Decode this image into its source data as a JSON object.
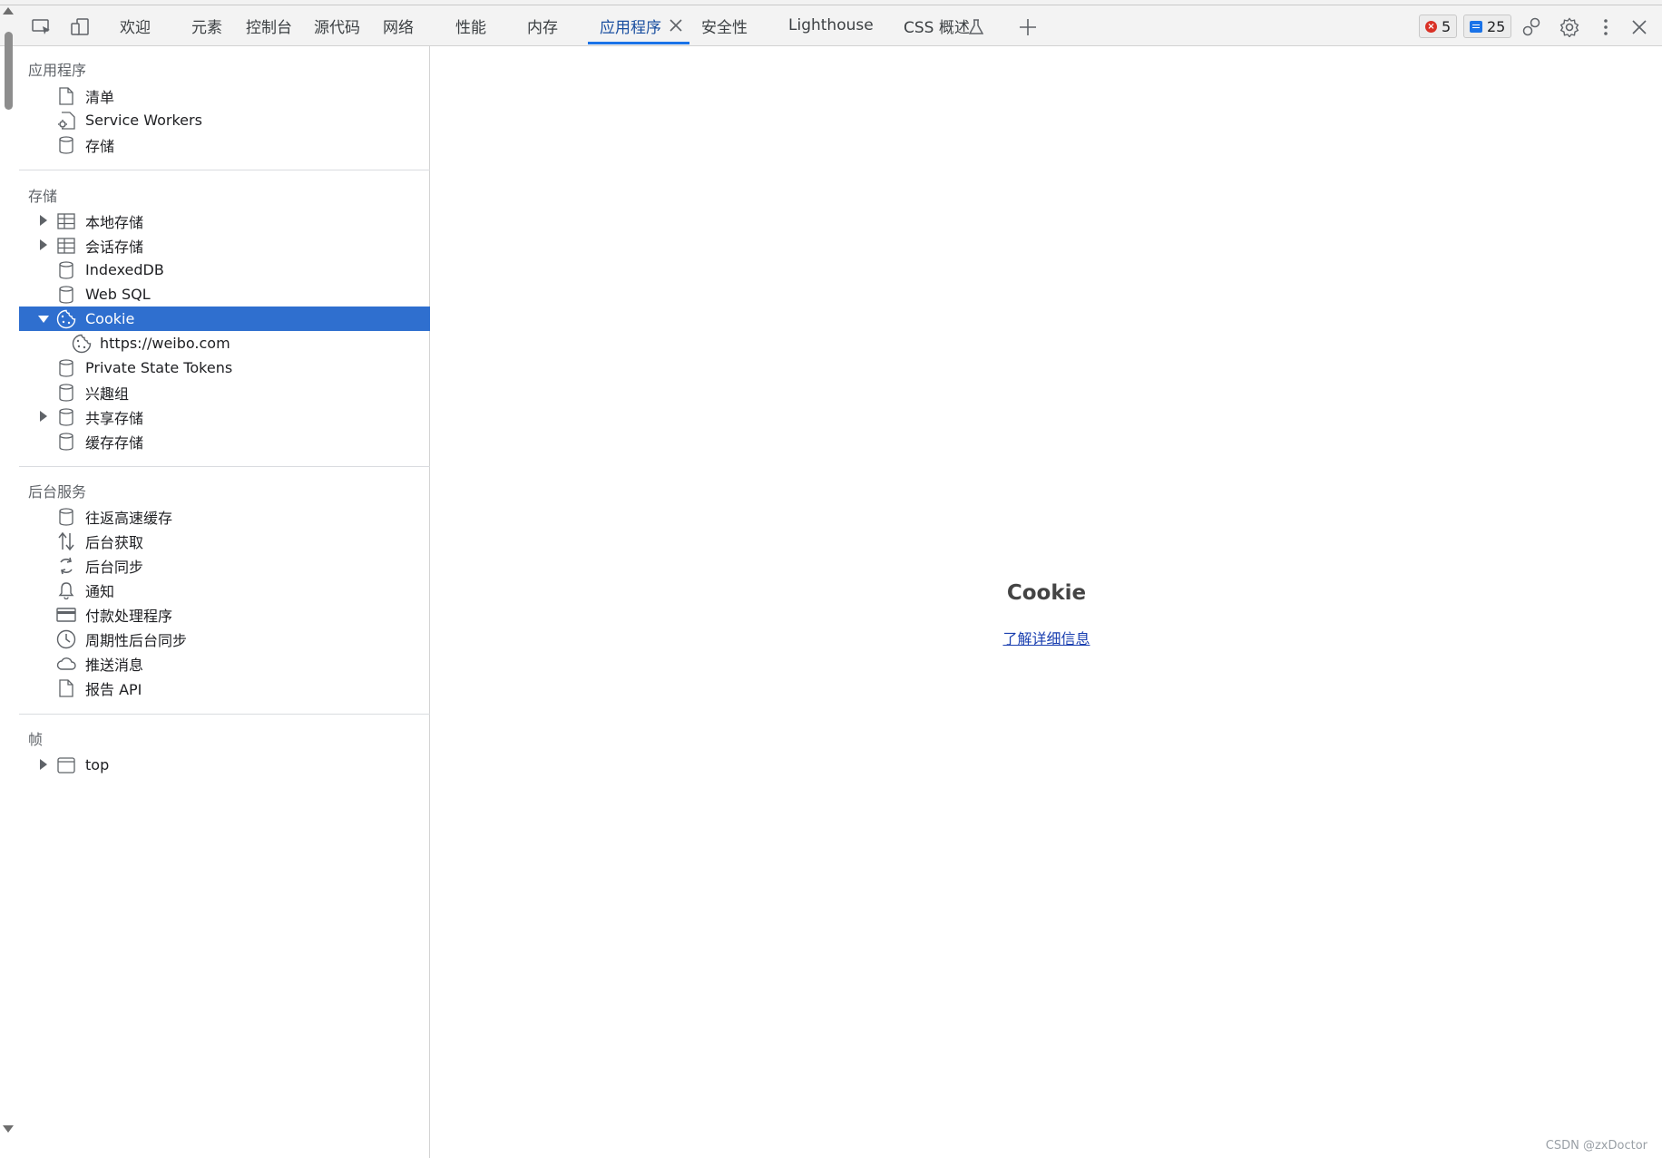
{
  "toolbar": {
    "tabs": [
      {
        "label": "欢迎"
      },
      {
        "label": "元素"
      },
      {
        "label": "控制台"
      },
      {
        "label": "源代码"
      },
      {
        "label": "网络"
      },
      {
        "label": "性能"
      },
      {
        "label": "内存"
      },
      {
        "label": "应用程序"
      },
      {
        "label": "安全性"
      },
      {
        "label": "Lighthouse"
      },
      {
        "label": "CSS 概述"
      }
    ],
    "active_tab": "应用程序",
    "error_count": "5",
    "message_count": "25"
  },
  "sidebar": {
    "app_section": {
      "title": "应用程序",
      "items": [
        {
          "label": "清单",
          "icon": "document-icon"
        },
        {
          "label": "Service Workers",
          "icon": "service-worker-icon"
        },
        {
          "label": "存储",
          "icon": "database-icon"
        }
      ]
    },
    "storage_section": {
      "title": "存储",
      "items": [
        {
          "label": "本地存储",
          "icon": "table-icon",
          "expandable": true
        },
        {
          "label": "会话存储",
          "icon": "table-icon",
          "expandable": true
        },
        {
          "label": "IndexedDB",
          "icon": "database-icon"
        },
        {
          "label": "Web SQL",
          "icon": "database-icon"
        },
        {
          "label": "Cookie",
          "icon": "cookie-icon",
          "expanded": true,
          "selected": true
        },
        {
          "label": "https://weibo.com",
          "icon": "cookie-icon",
          "child": true
        },
        {
          "label": "Private State Tokens",
          "icon": "database-icon"
        },
        {
          "label": "兴趣组",
          "icon": "database-icon"
        },
        {
          "label": "共享存储",
          "icon": "database-icon",
          "expandable": true
        },
        {
          "label": "缓存存储",
          "icon": "database-icon"
        }
      ]
    },
    "background_section": {
      "title": "后台服务",
      "items": [
        {
          "label": "往返高速缓存",
          "icon": "database-icon"
        },
        {
          "label": "后台获取",
          "icon": "arrows-updown-icon"
        },
        {
          "label": "后台同步",
          "icon": "sync-icon"
        },
        {
          "label": "通知",
          "icon": "bell-icon"
        },
        {
          "label": "付款处理程序",
          "icon": "credit-card-icon"
        },
        {
          "label": "周期性后台同步",
          "icon": "clock-icon"
        },
        {
          "label": "推送消息",
          "icon": "cloud-icon"
        },
        {
          "label": "报告 API",
          "icon": "document-icon"
        }
      ]
    },
    "frames_section": {
      "title": "帧",
      "items": [
        {
          "label": "top",
          "icon": "frame-icon",
          "expandable": true
        }
      ]
    }
  },
  "main": {
    "title": "Cookie",
    "learn_more": "了解详细信息"
  },
  "watermark": "CSDN @zxDoctor",
  "colors": {
    "selection": "#2f6fcf",
    "accent": "#1a73e8",
    "error": "#d93025"
  }
}
